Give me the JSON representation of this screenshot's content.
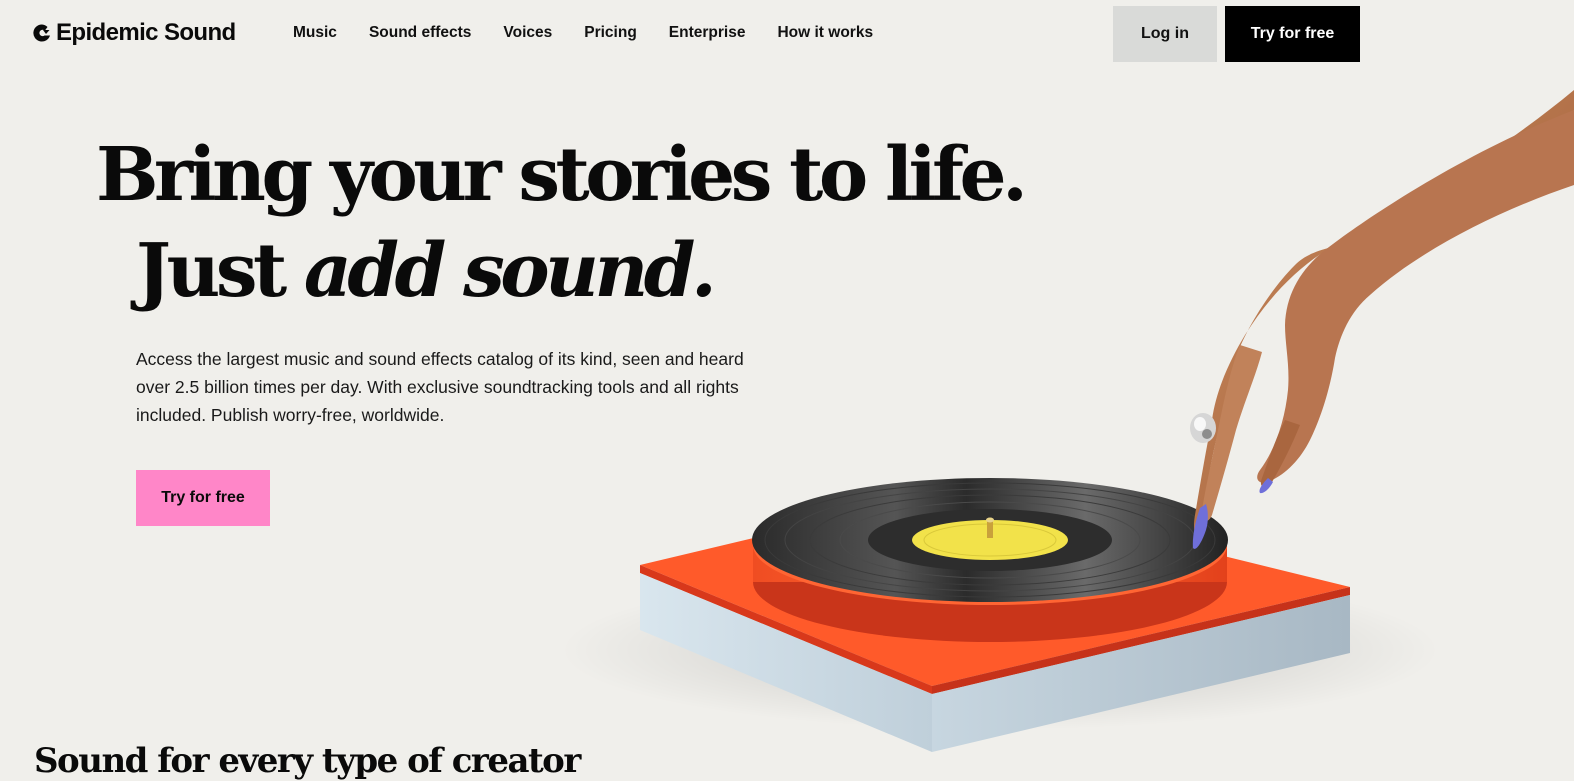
{
  "brand": {
    "name": "Epidemic Sound",
    "logo_icon": "epidemic-sound-logo-icon"
  },
  "nav": {
    "items": [
      {
        "label": "Music"
      },
      {
        "label": "Sound effects"
      },
      {
        "label": "Voices"
      },
      {
        "label": "Pricing"
      },
      {
        "label": "Enterprise"
      },
      {
        "label": "How it works"
      }
    ]
  },
  "header": {
    "login_label": "Log in",
    "try_label": "Try for free"
  },
  "hero": {
    "headline_line1": "Bring your stories to life.",
    "headline_line2_plain": "Just ",
    "headline_line2_italic": "add sound.",
    "description": "Access the largest music and sound effects catalog of its kind, seen and heard over 2.5 billion times per day. With exclusive soundtracking tools and all rights included. Publish worry-free, worldwide.",
    "cta_label": "Try for free"
  },
  "next_section": {
    "heading_peek": "Sound for every type of creator"
  },
  "colors": {
    "background": "#f0efeb",
    "cta_pink": "#ff86c8",
    "primary_black": "#000000",
    "login_gray": "#d9dad8",
    "turntable_orange": "#ff5a2a",
    "record_label_yellow": "#f2e24a"
  }
}
